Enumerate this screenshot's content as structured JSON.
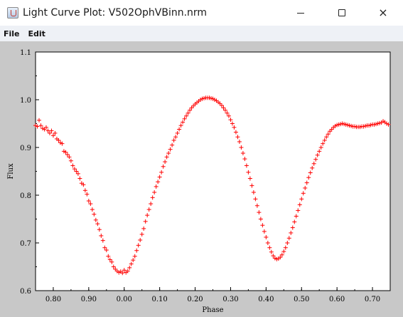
{
  "window": {
    "title": "Light Curve Plot: V502OphVBinn.nrm",
    "minimize_glyph": "minimize-icon",
    "maximize_glyph": "maximize-icon",
    "close_glyph": "×"
  },
  "menu": {
    "items": [
      "File",
      "Edit"
    ]
  },
  "colors": {
    "plot_background": "#ffffff",
    "panel_background": "#c8c8c8",
    "data_marker": "#ff0000"
  },
  "chart_data": {
    "type": "scatter",
    "marker": "+",
    "xlabel": "Phase",
    "ylabel": "Flux",
    "x_axis_note": "phase axis wraps: plotted range runs 0.75 → 1.00 (shown as 0.00) → 0.75",
    "xlim": [
      0.75,
      1.75
    ],
    "ylim": [
      0.6,
      1.1
    ],
    "x_ticks": [
      {
        "value": 0.8,
        "label": "0.80"
      },
      {
        "value": 0.9,
        "label": "0.90"
      },
      {
        "value": 1.0,
        "label": "0.00"
      },
      {
        "value": 1.1,
        "label": "0.10"
      },
      {
        "value": 1.2,
        "label": "0.20"
      },
      {
        "value": 1.3,
        "label": "0.30"
      },
      {
        "value": 1.4,
        "label": "0.40"
      },
      {
        "value": 1.5,
        "label": "0.50"
      },
      {
        "value": 1.6,
        "label": "0.60"
      },
      {
        "value": 1.7,
        "label": "0.70"
      }
    ],
    "y_ticks": [
      {
        "value": 0.6,
        "label": "0.6"
      },
      {
        "value": 0.7,
        "label": "0.7"
      },
      {
        "value": 0.8,
        "label": "0.8"
      },
      {
        "value": 0.9,
        "label": "0.9"
      },
      {
        "value": 1.0,
        "label": "1.0"
      },
      {
        "value": 1.1,
        "label": "1.1"
      }
    ],
    "points": [
      [
        0.75,
        0.946
      ],
      [
        0.755,
        0.944
      ],
      [
        0.76,
        0.957
      ],
      [
        0.765,
        0.946
      ],
      [
        0.77,
        0.94
      ],
      [
        0.775,
        0.938
      ],
      [
        0.78,
        0.942
      ],
      [
        0.785,
        0.935
      ],
      [
        0.79,
        0.93
      ],
      [
        0.795,
        0.935
      ],
      [
        0.8,
        0.925
      ],
      [
        0.805,
        0.93
      ],
      [
        0.81,
        0.918
      ],
      [
        0.815,
        0.915
      ],
      [
        0.82,
        0.91
      ],
      [
        0.825,
        0.908
      ],
      [
        0.83,
        0.892
      ],
      [
        0.835,
        0.89
      ],
      [
        0.84,
        0.885
      ],
      [
        0.845,
        0.88
      ],
      [
        0.85,
        0.872
      ],
      [
        0.855,
        0.862
      ],
      [
        0.86,
        0.855
      ],
      [
        0.865,
        0.85
      ],
      [
        0.87,
        0.845
      ],
      [
        0.875,
        0.835
      ],
      [
        0.88,
        0.825
      ],
      [
        0.885,
        0.822
      ],
      [
        0.89,
        0.81
      ],
      [
        0.895,
        0.802
      ],
      [
        0.9,
        0.788
      ],
      [
        0.905,
        0.782
      ],
      [
        0.91,
        0.77
      ],
      [
        0.915,
        0.76
      ],
      [
        0.92,
        0.748
      ],
      [
        0.925,
        0.74
      ],
      [
        0.93,
        0.728
      ],
      [
        0.935,
        0.715
      ],
      [
        0.94,
        0.705
      ],
      [
        0.945,
        0.69
      ],
      [
        0.95,
        0.685
      ],
      [
        0.955,
        0.672
      ],
      [
        0.96,
        0.665
      ],
      [
        0.965,
        0.66
      ],
      [
        0.97,
        0.65
      ],
      [
        0.975,
        0.645
      ],
      [
        0.98,
        0.641
      ],
      [
        0.985,
        0.638
      ],
      [
        0.99,
        0.64
      ],
      [
        0.995,
        0.637
      ],
      [
        1.0,
        0.643
      ],
      [
        1.005,
        0.638
      ],
      [
        1.01,
        0.641
      ],
      [
        1.015,
        0.648
      ],
      [
        1.02,
        0.656
      ],
      [
        1.025,
        0.664
      ],
      [
        1.03,
        0.672
      ],
      [
        1.035,
        0.684
      ],
      [
        1.04,
        0.695
      ],
      [
        1.045,
        0.706
      ],
      [
        1.05,
        0.718
      ],
      [
        1.055,
        0.73
      ],
      [
        1.06,
        0.745
      ],
      [
        1.065,
        0.758
      ],
      [
        1.07,
        0.77
      ],
      [
        1.075,
        0.782
      ],
      [
        1.08,
        0.795
      ],
      [
        1.085,
        0.806
      ],
      [
        1.09,
        0.818
      ],
      [
        1.095,
        0.828
      ],
      [
        1.1,
        0.838
      ],
      [
        1.105,
        0.848
      ],
      [
        1.11,
        0.86
      ],
      [
        1.115,
        0.87
      ],
      [
        1.12,
        0.88
      ],
      [
        1.125,
        0.888
      ],
      [
        1.13,
        0.896
      ],
      [
        1.135,
        0.905
      ],
      [
        1.14,
        0.915
      ],
      [
        1.145,
        0.922
      ],
      [
        1.15,
        0.93
      ],
      [
        1.155,
        0.938
      ],
      [
        1.16,
        0.946
      ],
      [
        1.165,
        0.953
      ],
      [
        1.17,
        0.96
      ],
      [
        1.175,
        0.966
      ],
      [
        1.18,
        0.972
      ],
      [
        1.185,
        0.978
      ],
      [
        1.19,
        0.983
      ],
      [
        1.195,
        0.987
      ],
      [
        1.2,
        0.991
      ],
      [
        1.205,
        0.994
      ],
      [
        1.21,
        0.997
      ],
      [
        1.215,
        1.0
      ],
      [
        1.22,
        1.002
      ],
      [
        1.225,
        1.003
      ],
      [
        1.23,
        1.004
      ],
      [
        1.235,
        1.004
      ],
      [
        1.24,
        1.004
      ],
      [
        1.245,
        1.003
      ],
      [
        1.25,
        1.002
      ],
      [
        1.255,
        1.0
      ],
      [
        1.26,
        0.998
      ],
      [
        1.265,
        0.995
      ],
      [
        1.27,
        0.992
      ],
      [
        1.275,
        0.988
      ],
      [
        1.28,
        0.983
      ],
      [
        1.285,
        0.978
      ],
      [
        1.29,
        0.972
      ],
      [
        1.295,
        0.966
      ],
      [
        1.3,
        0.958
      ],
      [
        1.305,
        0.95
      ],
      [
        1.31,
        0.942
      ],
      [
        1.315,
        0.932
      ],
      [
        1.32,
        0.922
      ],
      [
        1.325,
        0.912
      ],
      [
        1.33,
        0.9
      ],
      [
        1.335,
        0.888
      ],
      [
        1.34,
        0.876
      ],
      [
        1.345,
        0.862
      ],
      [
        1.35,
        0.848
      ],
      [
        1.355,
        0.835
      ],
      [
        1.36,
        0.82
      ],
      [
        1.365,
        0.806
      ],
      [
        1.37,
        0.792
      ],
      [
        1.375,
        0.778
      ],
      [
        1.38,
        0.764
      ],
      [
        1.385,
        0.75
      ],
      [
        1.39,
        0.737
      ],
      [
        1.395,
        0.724
      ],
      [
        1.4,
        0.712
      ],
      [
        1.405,
        0.7
      ],
      [
        1.41,
        0.69
      ],
      [
        1.415,
        0.681
      ],
      [
        1.42,
        0.673
      ],
      [
        1.425,
        0.668
      ],
      [
        1.43,
        0.666
      ],
      [
        1.435,
        0.667
      ],
      [
        1.44,
        0.67
      ],
      [
        1.445,
        0.675
      ],
      [
        1.45,
        0.682
      ],
      [
        1.455,
        0.69
      ],
      [
        1.46,
        0.7
      ],
      [
        1.465,
        0.71
      ],
      [
        1.47,
        0.721
      ],
      [
        1.475,
        0.732
      ],
      [
        1.48,
        0.744
      ],
      [
        1.485,
        0.756
      ],
      [
        1.49,
        0.768
      ],
      [
        1.495,
        0.78
      ],
      [
        1.5,
        0.792
      ],
      [
        1.505,
        0.804
      ],
      [
        1.51,
        0.815
      ],
      [
        1.515,
        0.826
      ],
      [
        1.52,
        0.837
      ],
      [
        1.525,
        0.847
      ],
      [
        1.53,
        0.857
      ],
      [
        1.535,
        0.866
      ],
      [
        1.54,
        0.875
      ],
      [
        1.545,
        0.884
      ],
      [
        1.55,
        0.892
      ],
      [
        1.555,
        0.9
      ],
      [
        1.56,
        0.908
      ],
      [
        1.565,
        0.915
      ],
      [
        1.57,
        0.922
      ],
      [
        1.575,
        0.928
      ],
      [
        1.58,
        0.934
      ],
      [
        1.585,
        0.938
      ],
      [
        1.59,
        0.942
      ],
      [
        1.595,
        0.945
      ],
      [
        1.6,
        0.947
      ],
      [
        1.605,
        0.948
      ],
      [
        1.61,
        0.949
      ],
      [
        1.615,
        0.95
      ],
      [
        1.62,
        0.949
      ],
      [
        1.625,
        0.948
      ],
      [
        1.63,
        0.947
      ],
      [
        1.635,
        0.946
      ],
      [
        1.64,
        0.945
      ],
      [
        1.645,
        0.944
      ],
      [
        1.65,
        0.944
      ],
      [
        1.655,
        0.943
      ],
      [
        1.66,
        0.943
      ],
      [
        1.665,
        0.943
      ],
      [
        1.67,
        0.944
      ],
      [
        1.675,
        0.944
      ],
      [
        1.68,
        0.945
      ],
      [
        1.685,
        0.946
      ],
      [
        1.69,
        0.946
      ],
      [
        1.695,
        0.947
      ],
      [
        1.7,
        0.948
      ],
      [
        1.705,
        0.948
      ],
      [
        1.71,
        0.949
      ],
      [
        1.715,
        0.95
      ],
      [
        1.72,
        0.951
      ],
      [
        1.725,
        0.952
      ],
      [
        1.73,
        0.955
      ],
      [
        1.735,
        0.953
      ],
      [
        1.74,
        0.95
      ],
      [
        1.745,
        0.948
      ]
    ]
  }
}
